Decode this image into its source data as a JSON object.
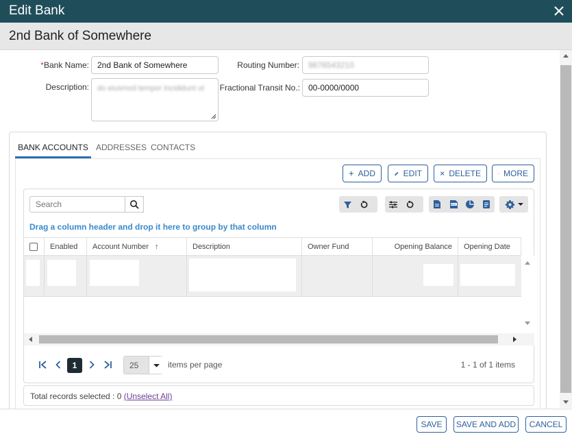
{
  "dialog": {
    "title": "Edit Bank"
  },
  "header": {
    "bank_display_name": "2nd Bank of Somewhere"
  },
  "form": {
    "bank_name": {
      "label": "Bank Name:",
      "required_mark": "*",
      "value": "2nd Bank of Somewhere"
    },
    "routing_number": {
      "label": "Routing Number:",
      "value": "9876543210"
    },
    "description": {
      "label": "Description:",
      "value": "do eiusmod tempor incididunt ut"
    },
    "fractional_transit": {
      "label": "Fractional Transit No.:",
      "value": "00-0000/0000"
    }
  },
  "tabs": [
    {
      "label": "BANK ACCOUNTS",
      "active": true
    },
    {
      "label": "ADDRESSES",
      "active": false
    },
    {
      "label": "CONTACTS",
      "active": false
    }
  ],
  "actions": {
    "add": "ADD",
    "edit": "EDIT",
    "delete": "DELETE",
    "more": "MORE"
  },
  "grid": {
    "search_placeholder": "Search",
    "group_hint": "Drag a column header and drop it here to group by that column",
    "columns": [
      {
        "label": ""
      },
      {
        "label": "Enabled"
      },
      {
        "label": "Account Number",
        "sort": "asc"
      },
      {
        "label": "Description"
      },
      {
        "label": "Owner Fund"
      },
      {
        "label": "Opening Balance"
      },
      {
        "label": "Opening Date"
      }
    ],
    "sort_indicator": "↑"
  },
  "pager": {
    "current_page": "1",
    "page_size": "25",
    "items_per_page_label": "items per page",
    "info": "1 - 1 of 1 items"
  },
  "totals": {
    "text": "Total records selected : 0",
    "unselect_all": "(Unselect All)"
  },
  "footer": {
    "save": "SAVE",
    "save_and_add": "SAVE AND ADD",
    "cancel": "CANCEL"
  },
  "colors": {
    "titlebar": "#1f4e5a",
    "accent": "#2d5f9b",
    "tab_underline": "#2d6fb4",
    "hint": "#3a89c9"
  }
}
